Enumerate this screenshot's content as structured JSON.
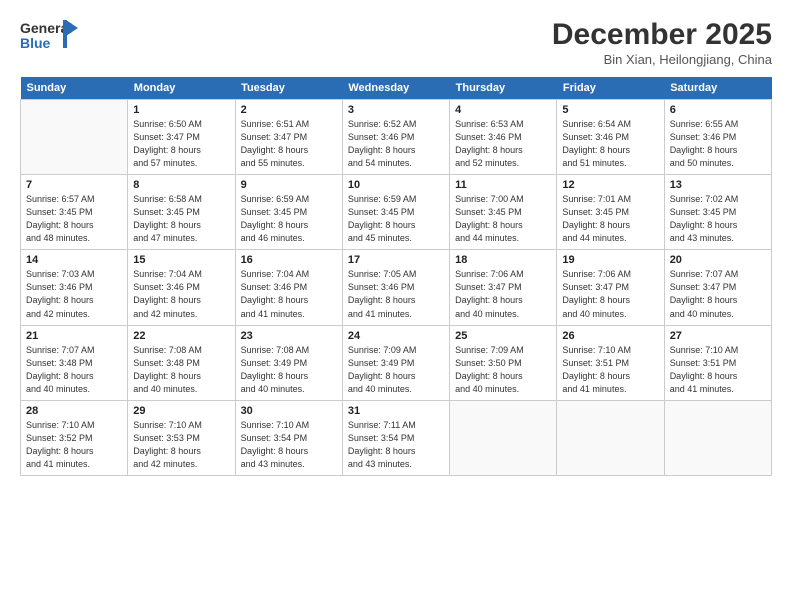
{
  "header": {
    "logo_line1": "General",
    "logo_line2": "Blue",
    "title": "December 2025",
    "subtitle": "Bin Xian, Heilongjiang, China"
  },
  "days_of_week": [
    "Sunday",
    "Monday",
    "Tuesday",
    "Wednesday",
    "Thursday",
    "Friday",
    "Saturday"
  ],
  "weeks": [
    [
      {
        "num": "",
        "text": ""
      },
      {
        "num": "1",
        "text": "Sunrise: 6:50 AM\nSunset: 3:47 PM\nDaylight: 8 hours\nand 57 minutes."
      },
      {
        "num": "2",
        "text": "Sunrise: 6:51 AM\nSunset: 3:47 PM\nDaylight: 8 hours\nand 55 minutes."
      },
      {
        "num": "3",
        "text": "Sunrise: 6:52 AM\nSunset: 3:46 PM\nDaylight: 8 hours\nand 54 minutes."
      },
      {
        "num": "4",
        "text": "Sunrise: 6:53 AM\nSunset: 3:46 PM\nDaylight: 8 hours\nand 52 minutes."
      },
      {
        "num": "5",
        "text": "Sunrise: 6:54 AM\nSunset: 3:46 PM\nDaylight: 8 hours\nand 51 minutes."
      },
      {
        "num": "6",
        "text": "Sunrise: 6:55 AM\nSunset: 3:46 PM\nDaylight: 8 hours\nand 50 minutes."
      }
    ],
    [
      {
        "num": "7",
        "text": "Sunrise: 6:57 AM\nSunset: 3:45 PM\nDaylight: 8 hours\nand 48 minutes."
      },
      {
        "num": "8",
        "text": "Sunrise: 6:58 AM\nSunset: 3:45 PM\nDaylight: 8 hours\nand 47 minutes."
      },
      {
        "num": "9",
        "text": "Sunrise: 6:59 AM\nSunset: 3:45 PM\nDaylight: 8 hours\nand 46 minutes."
      },
      {
        "num": "10",
        "text": "Sunrise: 6:59 AM\nSunset: 3:45 PM\nDaylight: 8 hours\nand 45 minutes."
      },
      {
        "num": "11",
        "text": "Sunrise: 7:00 AM\nSunset: 3:45 PM\nDaylight: 8 hours\nand 44 minutes."
      },
      {
        "num": "12",
        "text": "Sunrise: 7:01 AM\nSunset: 3:45 PM\nDaylight: 8 hours\nand 44 minutes."
      },
      {
        "num": "13",
        "text": "Sunrise: 7:02 AM\nSunset: 3:45 PM\nDaylight: 8 hours\nand 43 minutes."
      }
    ],
    [
      {
        "num": "14",
        "text": "Sunrise: 7:03 AM\nSunset: 3:46 PM\nDaylight: 8 hours\nand 42 minutes."
      },
      {
        "num": "15",
        "text": "Sunrise: 7:04 AM\nSunset: 3:46 PM\nDaylight: 8 hours\nand 42 minutes."
      },
      {
        "num": "16",
        "text": "Sunrise: 7:04 AM\nSunset: 3:46 PM\nDaylight: 8 hours\nand 41 minutes."
      },
      {
        "num": "17",
        "text": "Sunrise: 7:05 AM\nSunset: 3:46 PM\nDaylight: 8 hours\nand 41 minutes."
      },
      {
        "num": "18",
        "text": "Sunrise: 7:06 AM\nSunset: 3:47 PM\nDaylight: 8 hours\nand 40 minutes."
      },
      {
        "num": "19",
        "text": "Sunrise: 7:06 AM\nSunset: 3:47 PM\nDaylight: 8 hours\nand 40 minutes."
      },
      {
        "num": "20",
        "text": "Sunrise: 7:07 AM\nSunset: 3:47 PM\nDaylight: 8 hours\nand 40 minutes."
      }
    ],
    [
      {
        "num": "21",
        "text": "Sunrise: 7:07 AM\nSunset: 3:48 PM\nDaylight: 8 hours\nand 40 minutes."
      },
      {
        "num": "22",
        "text": "Sunrise: 7:08 AM\nSunset: 3:48 PM\nDaylight: 8 hours\nand 40 minutes."
      },
      {
        "num": "23",
        "text": "Sunrise: 7:08 AM\nSunset: 3:49 PM\nDaylight: 8 hours\nand 40 minutes."
      },
      {
        "num": "24",
        "text": "Sunrise: 7:09 AM\nSunset: 3:49 PM\nDaylight: 8 hours\nand 40 minutes."
      },
      {
        "num": "25",
        "text": "Sunrise: 7:09 AM\nSunset: 3:50 PM\nDaylight: 8 hours\nand 40 minutes."
      },
      {
        "num": "26",
        "text": "Sunrise: 7:10 AM\nSunset: 3:51 PM\nDaylight: 8 hours\nand 41 minutes."
      },
      {
        "num": "27",
        "text": "Sunrise: 7:10 AM\nSunset: 3:51 PM\nDaylight: 8 hours\nand 41 minutes."
      }
    ],
    [
      {
        "num": "28",
        "text": "Sunrise: 7:10 AM\nSunset: 3:52 PM\nDaylight: 8 hours\nand 41 minutes."
      },
      {
        "num": "29",
        "text": "Sunrise: 7:10 AM\nSunset: 3:53 PM\nDaylight: 8 hours\nand 42 minutes."
      },
      {
        "num": "30",
        "text": "Sunrise: 7:10 AM\nSunset: 3:54 PM\nDaylight: 8 hours\nand 43 minutes."
      },
      {
        "num": "31",
        "text": "Sunrise: 7:11 AM\nSunset: 3:54 PM\nDaylight: 8 hours\nand 43 minutes."
      },
      {
        "num": "",
        "text": ""
      },
      {
        "num": "",
        "text": ""
      },
      {
        "num": "",
        "text": ""
      }
    ]
  ]
}
